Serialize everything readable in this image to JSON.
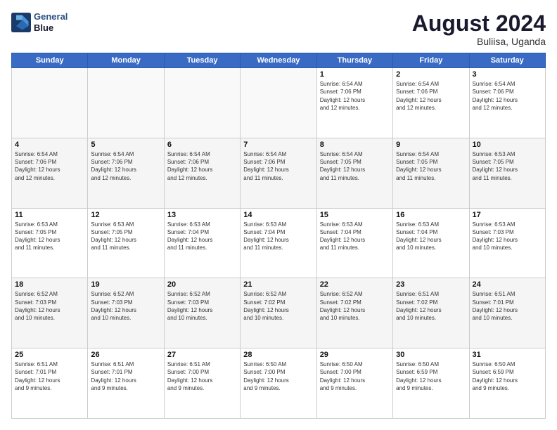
{
  "header": {
    "logo_general": "General",
    "logo_blue": "Blue",
    "main_title": "August 2024",
    "subtitle": "Buliisa, Uganda"
  },
  "days_of_week": [
    "Sunday",
    "Monday",
    "Tuesday",
    "Wednesday",
    "Thursday",
    "Friday",
    "Saturday"
  ],
  "weeks": [
    [
      {
        "day": "",
        "info": "",
        "empty": true
      },
      {
        "day": "",
        "info": "",
        "empty": true
      },
      {
        "day": "",
        "info": "",
        "empty": true
      },
      {
        "day": "",
        "info": "",
        "empty": true
      },
      {
        "day": "1",
        "info": "Sunrise: 6:54 AM\nSunset: 7:06 PM\nDaylight: 12 hours\nand 12 minutes."
      },
      {
        "day": "2",
        "info": "Sunrise: 6:54 AM\nSunset: 7:06 PM\nDaylight: 12 hours\nand 12 minutes."
      },
      {
        "day": "3",
        "info": "Sunrise: 6:54 AM\nSunset: 7:06 PM\nDaylight: 12 hours\nand 12 minutes."
      }
    ],
    [
      {
        "day": "4",
        "info": "Sunrise: 6:54 AM\nSunset: 7:06 PM\nDaylight: 12 hours\nand 12 minutes."
      },
      {
        "day": "5",
        "info": "Sunrise: 6:54 AM\nSunset: 7:06 PM\nDaylight: 12 hours\nand 12 minutes."
      },
      {
        "day": "6",
        "info": "Sunrise: 6:54 AM\nSunset: 7:06 PM\nDaylight: 12 hours\nand 12 minutes."
      },
      {
        "day": "7",
        "info": "Sunrise: 6:54 AM\nSunset: 7:06 PM\nDaylight: 12 hours\nand 11 minutes."
      },
      {
        "day": "8",
        "info": "Sunrise: 6:54 AM\nSunset: 7:05 PM\nDaylight: 12 hours\nand 11 minutes."
      },
      {
        "day": "9",
        "info": "Sunrise: 6:54 AM\nSunset: 7:05 PM\nDaylight: 12 hours\nand 11 minutes."
      },
      {
        "day": "10",
        "info": "Sunrise: 6:53 AM\nSunset: 7:05 PM\nDaylight: 12 hours\nand 11 minutes."
      }
    ],
    [
      {
        "day": "11",
        "info": "Sunrise: 6:53 AM\nSunset: 7:05 PM\nDaylight: 12 hours\nand 11 minutes."
      },
      {
        "day": "12",
        "info": "Sunrise: 6:53 AM\nSunset: 7:05 PM\nDaylight: 12 hours\nand 11 minutes."
      },
      {
        "day": "13",
        "info": "Sunrise: 6:53 AM\nSunset: 7:04 PM\nDaylight: 12 hours\nand 11 minutes."
      },
      {
        "day": "14",
        "info": "Sunrise: 6:53 AM\nSunset: 7:04 PM\nDaylight: 12 hours\nand 11 minutes."
      },
      {
        "day": "15",
        "info": "Sunrise: 6:53 AM\nSunset: 7:04 PM\nDaylight: 12 hours\nand 11 minutes."
      },
      {
        "day": "16",
        "info": "Sunrise: 6:53 AM\nSunset: 7:04 PM\nDaylight: 12 hours\nand 10 minutes."
      },
      {
        "day": "17",
        "info": "Sunrise: 6:53 AM\nSunset: 7:03 PM\nDaylight: 12 hours\nand 10 minutes."
      }
    ],
    [
      {
        "day": "18",
        "info": "Sunrise: 6:52 AM\nSunset: 7:03 PM\nDaylight: 12 hours\nand 10 minutes."
      },
      {
        "day": "19",
        "info": "Sunrise: 6:52 AM\nSunset: 7:03 PM\nDaylight: 12 hours\nand 10 minutes."
      },
      {
        "day": "20",
        "info": "Sunrise: 6:52 AM\nSunset: 7:03 PM\nDaylight: 12 hours\nand 10 minutes."
      },
      {
        "day": "21",
        "info": "Sunrise: 6:52 AM\nSunset: 7:02 PM\nDaylight: 12 hours\nand 10 minutes."
      },
      {
        "day": "22",
        "info": "Sunrise: 6:52 AM\nSunset: 7:02 PM\nDaylight: 12 hours\nand 10 minutes."
      },
      {
        "day": "23",
        "info": "Sunrise: 6:51 AM\nSunset: 7:02 PM\nDaylight: 12 hours\nand 10 minutes."
      },
      {
        "day": "24",
        "info": "Sunrise: 6:51 AM\nSunset: 7:01 PM\nDaylight: 12 hours\nand 10 minutes."
      }
    ],
    [
      {
        "day": "25",
        "info": "Sunrise: 6:51 AM\nSunset: 7:01 PM\nDaylight: 12 hours\nand 9 minutes."
      },
      {
        "day": "26",
        "info": "Sunrise: 6:51 AM\nSunset: 7:01 PM\nDaylight: 12 hours\nand 9 minutes."
      },
      {
        "day": "27",
        "info": "Sunrise: 6:51 AM\nSunset: 7:00 PM\nDaylight: 12 hours\nand 9 minutes."
      },
      {
        "day": "28",
        "info": "Sunrise: 6:50 AM\nSunset: 7:00 PM\nDaylight: 12 hours\nand 9 minutes."
      },
      {
        "day": "29",
        "info": "Sunrise: 6:50 AM\nSunset: 7:00 PM\nDaylight: 12 hours\nand 9 minutes."
      },
      {
        "day": "30",
        "info": "Sunrise: 6:50 AM\nSunset: 6:59 PM\nDaylight: 12 hours\nand 9 minutes."
      },
      {
        "day": "31",
        "info": "Sunrise: 6:50 AM\nSunset: 6:59 PM\nDaylight: 12 hours\nand 9 minutes."
      }
    ]
  ]
}
